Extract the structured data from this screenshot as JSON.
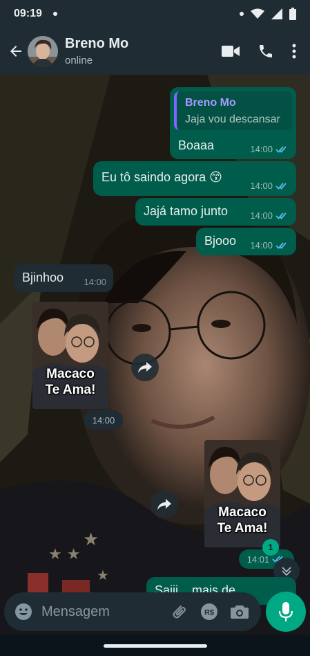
{
  "status_bar": {
    "time": "09:19"
  },
  "header": {
    "contact_name": "Breno Mo",
    "contact_status": "online"
  },
  "messages": [
    {
      "direction": "out",
      "quote_name": "Breno Mo",
      "quote_text": "Jaja vou descansar",
      "text": "Boaaa",
      "time": "14:00",
      "ticks": "read"
    },
    {
      "direction": "out",
      "text": "Eu tô saindo agora 😙",
      "time": "14:00",
      "ticks": "read"
    },
    {
      "direction": "out",
      "text": "Jajá tamo junto",
      "time": "14:00",
      "ticks": "read"
    },
    {
      "direction": "out",
      "text": "Bjooo",
      "time": "14:00",
      "ticks": "read"
    },
    {
      "direction": "in",
      "text": "Bjinhoo",
      "time": "14:00"
    },
    {
      "direction": "in",
      "type": "sticker",
      "caption_line1": "Macaco",
      "caption_line2": "Te Ama!",
      "time": "14:00"
    },
    {
      "direction": "out",
      "type": "sticker",
      "caption_line1": "Macaco",
      "caption_line2": "Te Ama!",
      "time": "14:01",
      "ticks": "read"
    }
  ],
  "partial_message_text": "Sajjj... mais de",
  "unread_count": "1",
  "composer": {
    "placeholder": "Mensagem"
  },
  "colors": {
    "header": "#1f2c34",
    "outgoing_bubble": "#005c4b",
    "incoming_bubble": "#1f2c34",
    "accent": "#00a884",
    "read_ticks": "#53bdeb"
  }
}
